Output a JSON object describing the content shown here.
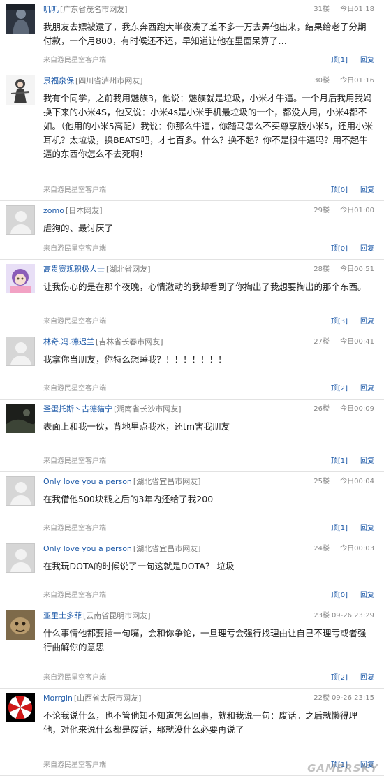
{
  "comments": [
    {
      "name": "叽叽",
      "location": "[广东省茂名市网友]",
      "floor": "31楼",
      "time": "今日01:18",
      "content": "我朋友去嫖被逮了，我东奔西跑大半夜凑了差不多一万去弄他出来，结果给老子分期付款，一个月800，有时候还不还，早知道让他在里面呆算了…",
      "source": "来自游民星空客户端",
      "like": "顶[1]",
      "reply": "回复",
      "avatar": "dark-figure"
    },
    {
      "name": "景福泉保",
      "location": "[四川省泸州市网友]",
      "floor": "30楼",
      "time": "今日01:16",
      "content": "我有个同学，之前我用魅族3，他说：魅族就是垃圾，小米才牛逼。一个月后我用我妈换下来的小米4S，他又说：小米4s是小米手机最垃圾的一个，都没人用，小米4都不如。（他用的小米5高配）我说：你那么牛逼，你踏马怎么不买尊享版小米5，还用小米耳机？太垃圾，换BEATS吧，才七百多。什么？换不起？你不是很牛逼吗？用不起牛逼的东西你怎么不去死啊！",
      "source": "来自游民星空客户端",
      "like": "顶[0]",
      "reply": "回复",
      "avatar": "anime-girl"
    },
    {
      "name": "zomo",
      "location": "[日本网友]",
      "floor": "29楼",
      "time": "今日01:00",
      "content": "虐狗的、最讨厌了",
      "source": "来自游民星空客户端",
      "like": "顶[0]",
      "reply": "回复",
      "avatar": "default"
    },
    {
      "name": "高贵赛观积极人士",
      "location": "[湖北省网友]",
      "floor": "28楼",
      "time": "今日00:51",
      "content": "让我伤心的是在那个夜晚，心情激动的我却看到了你掏出了我想要掏出的那个东西。",
      "source": "来自游民星空客户端",
      "like": "顶[3]",
      "reply": "回复",
      "avatar": "anime-purple"
    },
    {
      "name": "林奇.冯.德迟兰",
      "location": "[吉林省长春市网友]",
      "floor": "27楼",
      "time": "今日00:41",
      "content": "我拿你当朋友，你特么想睡我？！！！！！！！",
      "source": "来自游民星空客户端",
      "like": "顶[2]",
      "reply": "回复",
      "avatar": "default"
    },
    {
      "name": "圣蛋托斯丶古德猫宁",
      "location": "[湖南省长沙市网友]",
      "floor": "26楼",
      "time": "今日00:09",
      "content": "表面上和我一伙，背地里点我水，还tm害我朋友",
      "source": "来自游民星空客户端",
      "like": "顶[1]",
      "reply": "回复",
      "avatar": "dark-scene"
    },
    {
      "name": "Only love you a person",
      "location": "[湖北省宜昌市网友]",
      "floor": "25楼",
      "time": "今日00:04",
      "content": "在我借他500块钱之后的3年内还给了我200",
      "source": "来自游民星空客户端",
      "like": "顶[1]",
      "reply": "回复",
      "avatar": "default"
    },
    {
      "name": "Only love you a person",
      "location": "[湖北省宜昌市网友]",
      "floor": "24楼",
      "time": "今日00:03",
      "content": "在我玩DOTA的时候说了一句这就是DOTA？ 垃圾",
      "source": "来自游民星空客户端",
      "like": "顶[0]",
      "reply": "回复",
      "avatar": "default"
    },
    {
      "name": "亚里士多菲",
      "location": "[云南省昆明市网友]",
      "floor": "23楼",
      "time": "09-26 23:29",
      "content": "什么事情他都要插一句嘴，会和你争论，一旦理亏会强行找理由让自己不理亏或者强行曲解你的意思",
      "source": "来自游民星空客户端",
      "like": "顶[2]",
      "reply": "回复",
      "avatar": "creature"
    },
    {
      "name": "Morrgin",
      "location": "[山西省太原市网友]",
      "floor": "22楼",
      "time": "09-26 23:15",
      "content": "不论我说什么，也不管他知不知道怎么回事，就和我说一句：废话。之后就懒得理他，对他来说什么都是废话，那就没什么必要再说了",
      "source": "来自游民星空客户端",
      "like": "顶[1]",
      "reply": "回复",
      "avatar": "umbrella-logo"
    }
  ],
  "watermark": "GAMERSKY"
}
